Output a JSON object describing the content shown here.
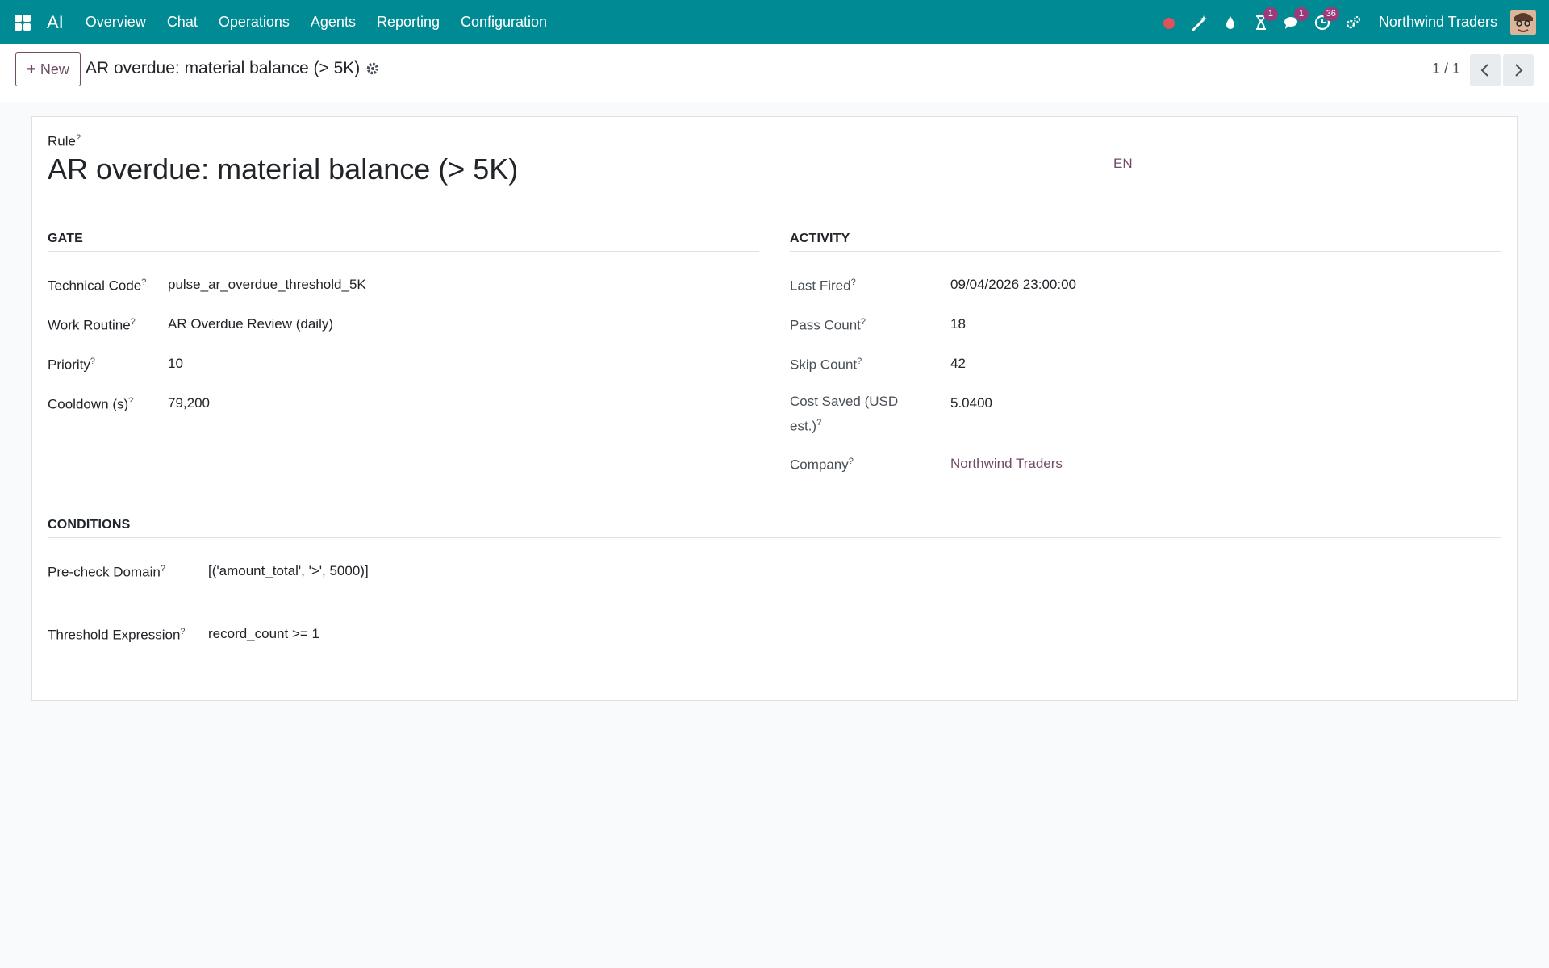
{
  "navbar": {
    "app_name": "AI",
    "menu": [
      "Overview",
      "Chat",
      "Operations",
      "Agents",
      "Reporting",
      "Configuration"
    ],
    "activity_badge": "1",
    "messages_badge": "1",
    "clock_badge": "36",
    "company": "Northwind Traders",
    "color": "#008b94"
  },
  "control_panel": {
    "new_label": "New",
    "breadcrumb": "AR overdue: material balance (> 5K)",
    "pager": "1 / 1"
  },
  "sheet": {
    "rule_label": "Rule",
    "title": "AR overdue: material balance (> 5K)",
    "lang": "EN",
    "gate": {
      "heading": "GATE",
      "fields": [
        {
          "label": "Technical Code",
          "value": "pulse_ar_overdue_threshold_5K"
        },
        {
          "label": "Work Routine",
          "value": "AR Overdue Review (daily)"
        },
        {
          "label": "Priority",
          "value": "10"
        },
        {
          "label": "Cooldown (s)",
          "value": "79,200"
        }
      ]
    },
    "activity": {
      "heading": "ACTIVITY",
      "fields": [
        {
          "label": "Last Fired",
          "value": "09/04/2026 23:00:00"
        },
        {
          "label": "Pass Count",
          "value": "18"
        },
        {
          "label": "Skip Count",
          "value": "42"
        },
        {
          "label_line1": "Cost Saved (USD",
          "label_line2": "est.)",
          "value": "5.0400"
        },
        {
          "label": "Company",
          "value": "Northwind Traders"
        }
      ]
    },
    "conditions": {
      "heading": "CONDITIONS",
      "fields": [
        {
          "label": "Pre-check Domain",
          "value": "[('amount_total', '>', 5000)]"
        },
        {
          "label": "Threshold Expression",
          "value": "record_count >= 1"
        }
      ]
    },
    "help_mark": "?"
  }
}
